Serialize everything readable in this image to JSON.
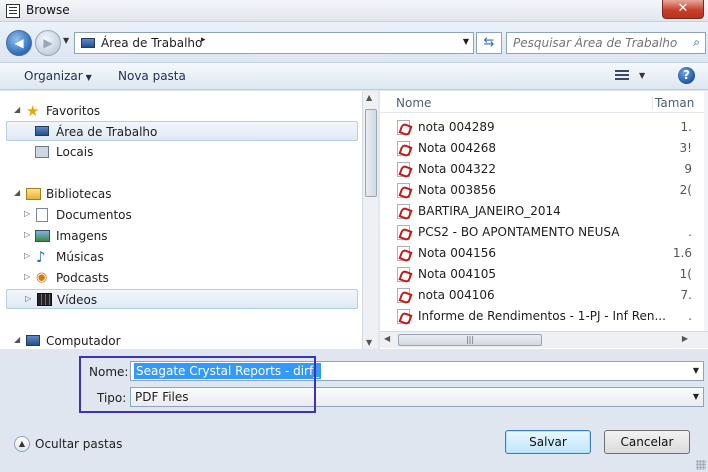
{
  "window": {
    "title": "Browse",
    "close_label": "✕"
  },
  "address": {
    "segments": [
      "Área de Trabalho"
    ],
    "separator": "▸",
    "dropdown": "▾"
  },
  "search": {
    "placeholder": "Pesquisar Área de Trabalho"
  },
  "toolbar": {
    "organize_label": "Organizar",
    "new_folder_label": "Nova pasta",
    "help_label": "?"
  },
  "nav": {
    "items": [
      {
        "label": "Favoritos",
        "icon": "star-icon"
      },
      {
        "label": "Área de Trabalho",
        "icon": "desktop-icon"
      },
      {
        "label": "Locais",
        "icon": "places-icon"
      },
      {
        "label": "Bibliotecas",
        "icon": "library-icon"
      },
      {
        "label": "Documentos",
        "icon": "documents-icon"
      },
      {
        "label": "Imagens",
        "icon": "images-icon"
      },
      {
        "label": "Músicas",
        "icon": "music-icon"
      },
      {
        "label": "Podcasts",
        "icon": "podcast-icon"
      },
      {
        "label": "Vídeos",
        "icon": "videos-icon"
      },
      {
        "label": "Computador",
        "icon": "computer-icon"
      }
    ]
  },
  "files": {
    "columns": {
      "name": "Nome",
      "size": "Taman"
    },
    "rows": [
      {
        "name": "nota 004289",
        "size": "1."
      },
      {
        "name": "Nota 004268",
        "size": "3!"
      },
      {
        "name": "Nota 004322",
        "size": "9"
      },
      {
        "name": "Nota 003856",
        "size": "2("
      },
      {
        "name": "BARTIRA_JANEIRO_2014",
        "size": ""
      },
      {
        "name": "PCS2 - BO APONTAMENTO NEUSA",
        "size": "."
      },
      {
        "name": "Nota 004156",
        "size": "1.6"
      },
      {
        "name": "Nota 004105",
        "size": "1("
      },
      {
        "name": "nota 004106",
        "size": "7."
      },
      {
        "name": "Informe de Rendimentos - 1-PJ - Inf Ren...",
        "size": "."
      }
    ]
  },
  "form": {
    "name_label": "Nome:",
    "name_value": "Seagate Crystal Reports - dirf_",
    "type_label": "Tipo:",
    "type_value": "PDF Files"
  },
  "footer": {
    "hide_folders_label": "Ocultar pastas",
    "save_label": "Salvar",
    "cancel_label": "Cancelar"
  }
}
